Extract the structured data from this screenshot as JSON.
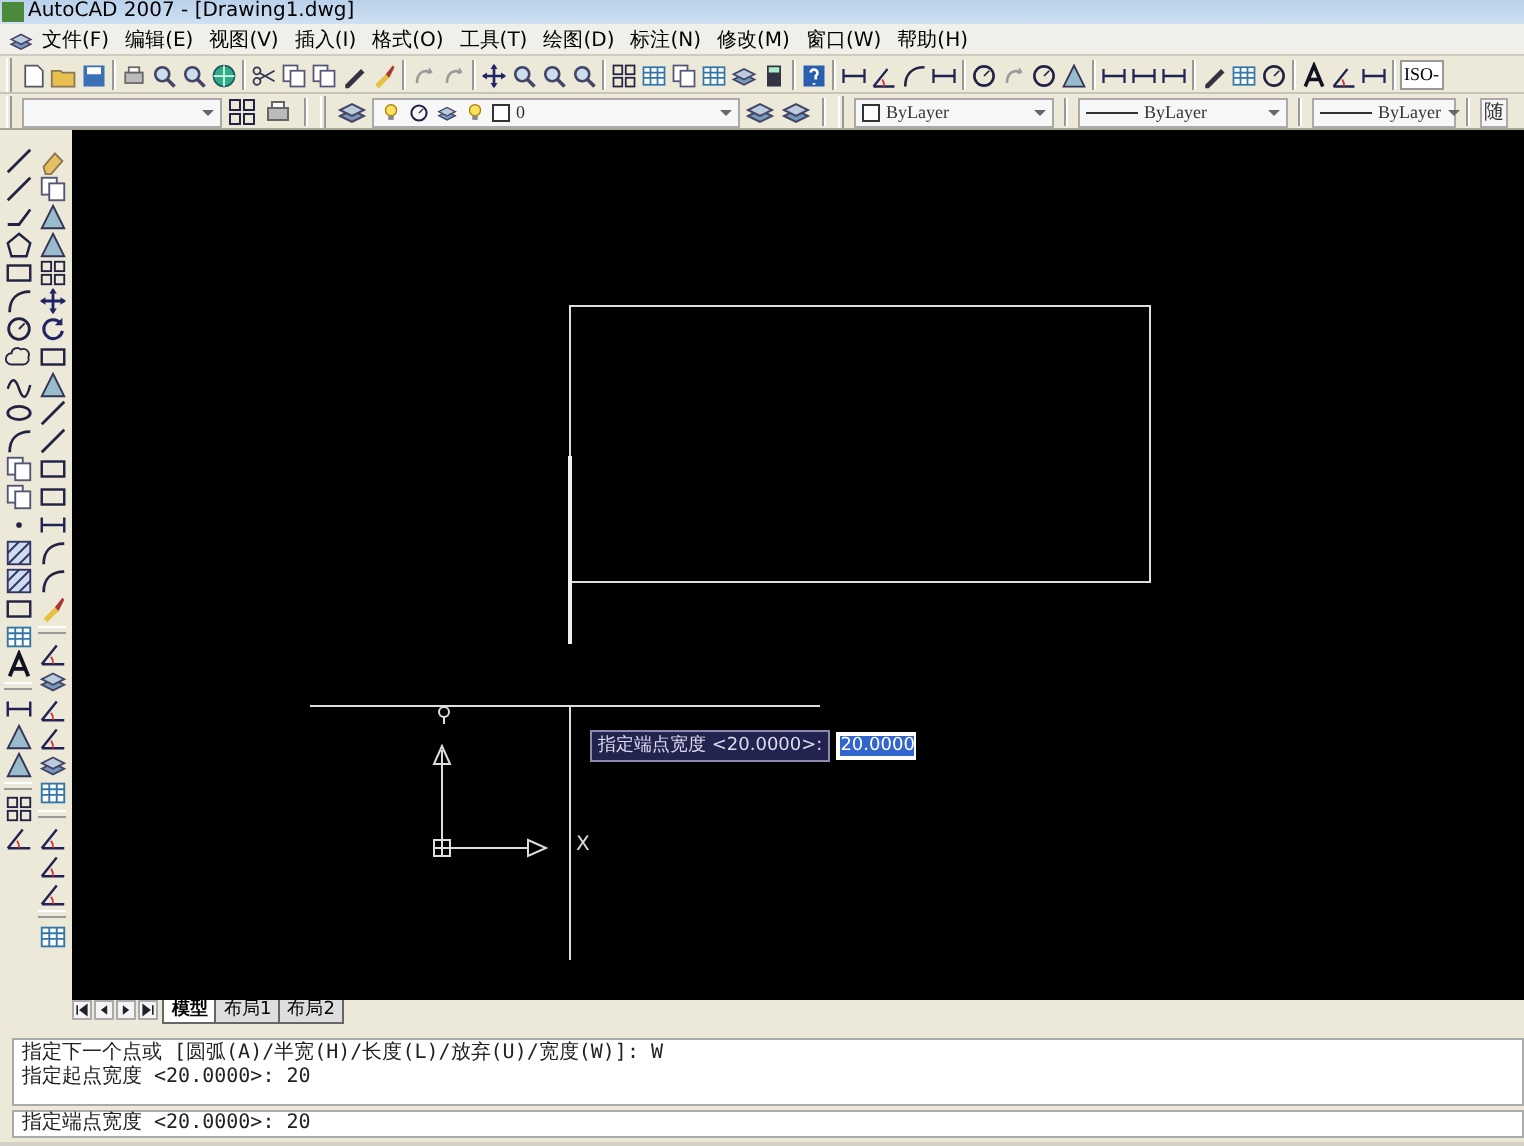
{
  "window": {
    "title": "AutoCAD 2007 - [Drawing1.dwg]"
  },
  "menu": [
    "文件(F)",
    "编辑(E)",
    "视图(V)",
    "插入(I)",
    "格式(O)",
    "工具(T)",
    "绘图(D)",
    "标注(N)",
    "修改(M)",
    "窗口(W)",
    "帮助(H)"
  ],
  "toolbar_standard": {
    "text_style": "ISO-"
  },
  "toolbar_layers": {
    "layer_name": "0",
    "color_control": "ByLayer",
    "linetype": "ByLayer",
    "lineweight": "ByLayer",
    "plot_style": "随"
  },
  "drawing": {
    "ucs_x_label": "X"
  },
  "dynamic_input": {
    "prompt": "指定端点宽度 <20.0000>:",
    "value": "20.0000",
    "value_selected": true
  },
  "layout_tabs": [
    {
      "label": "模型",
      "selected": true
    },
    {
      "label": "布局1",
      "selected": false
    },
    {
      "label": "布局2",
      "selected": false
    }
  ],
  "command_history": [
    "指定下一个点或 [圆弧(A)/半宽(H)/长度(L)/放弃(U)/宽度(W)]: W",
    "指定起点宽度 <20.0000>: 20"
  ],
  "command_line": "指定端点宽度 <20.0000>: 20"
}
